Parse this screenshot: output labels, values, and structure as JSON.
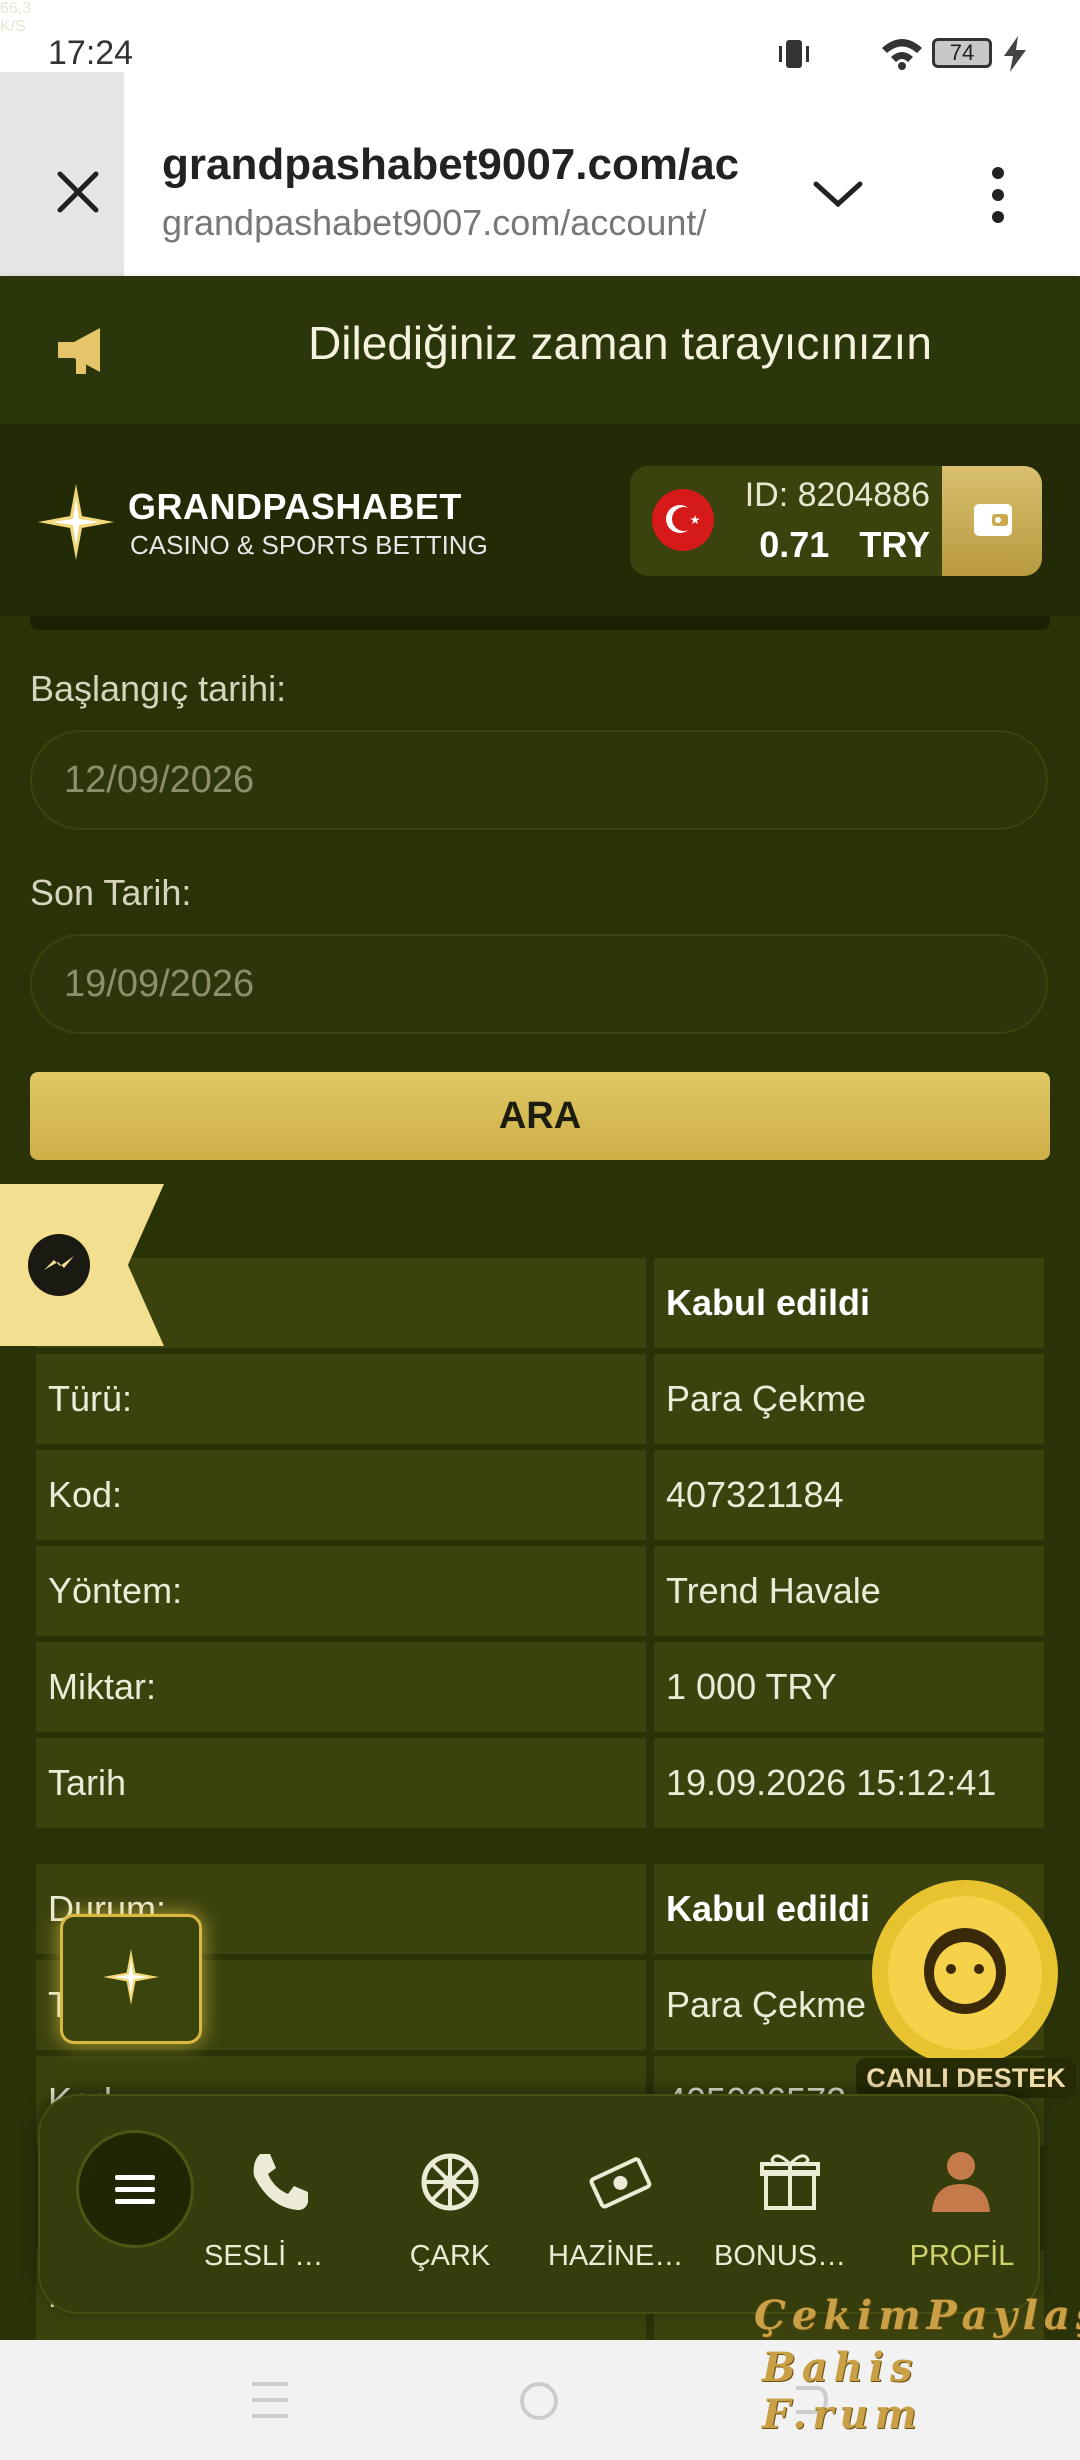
{
  "status_bar": {
    "time": "17:24",
    "speed_value": "66,3",
    "speed_unit": "K/S",
    "battery": "74"
  },
  "browser": {
    "url_main": "grandpashabet9007.com/ac",
    "url_sub": "grandpashabet9007.com/account/"
  },
  "announcement": {
    "text": "Dilediğiniz zaman tarayıcınızın"
  },
  "header": {
    "brand_name": "GRANDPASHABET",
    "brand_sub": "CASINO & SPORTS BETTING",
    "account_id": "ID: 8204886",
    "balance": "0.71",
    "currency": "TRY"
  },
  "filter": {
    "start_label": "Başlangıç tarihi:",
    "start_value": "12/09/2026",
    "end_label": "Son Tarih:",
    "end_value": "19/09/2026",
    "search_button": "ARA"
  },
  "transactions": [
    {
      "rows": [
        {
          "label": "m:",
          "value": "Kabul edildi"
        },
        {
          "label": "Türü:",
          "value": "Para Çekme"
        },
        {
          "label": "Kod:",
          "value": "407321184"
        },
        {
          "label": "Yöntem:",
          "value": "Trend Havale"
        },
        {
          "label": "Miktar:",
          "value": "1 000 TRY"
        },
        {
          "label": "Tarih",
          "value": "19.09.2026 15:12:41"
        }
      ]
    },
    {
      "rows": [
        {
          "label": "Durum:",
          "value": "Kabul edildi"
        },
        {
          "label": "T",
          "value": "Para Çekme"
        },
        {
          "label": "Kod:",
          "value": "405026572"
        },
        {
          "label": "Mi",
          "value": ""
        }
      ]
    }
  ],
  "support": {
    "label": "CANLI DESTEK"
  },
  "bottom_nav": {
    "items": [
      {
        "label": "SESLİ DESTEK",
        "icon": "phone-icon"
      },
      {
        "label": "ÇARK",
        "icon": "wheel-icon"
      },
      {
        "label": "HAZİNE AVI",
        "icon": "money-icon"
      },
      {
        "label": "BONUSLAR",
        "icon": "gift-icon"
      },
      {
        "label": "PROFİL",
        "icon": "profile-icon"
      }
    ],
    "active_color": "#cdd26a"
  },
  "watermark": {
    "line1": "ÇekimPaylaş",
    "line2": "Bahis F.rum"
  },
  "colors": {
    "accent_gold": "#d4b95a",
    "background": "#2a3308",
    "cell": "#3b420e"
  }
}
